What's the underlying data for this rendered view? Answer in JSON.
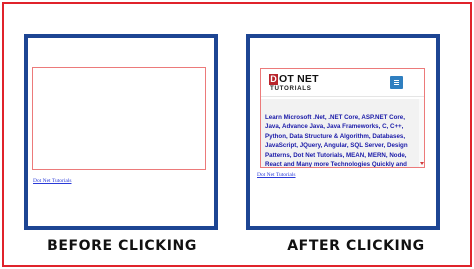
{
  "before": {
    "link_text": "Dot Net Tutorials",
    "caption": "BEFORE CLICKING"
  },
  "after": {
    "logo": {
      "box_letter": "D",
      "top_text": "OT NET",
      "bottom_text": "TUTORIALS"
    },
    "menu_icon": "hamburger-menu-icon",
    "content_text": "Learn Microsoft .Net, .NET Core, ASP.NET Core, Java, Advance Java, Java Frameworks, C, C++, Python, Data Structure & Algorithm, Databases, JavaScript, JQuery, Angular, SQL Server, Design Patterns, Dot Net Tutorials, MEAN, MERN, Node, React and Many more Technologies Quickly and",
    "link_text": "Dot Net Tutorials",
    "caption": "AFTER CLICKING"
  },
  "colors": {
    "outer_border": "#e0232b",
    "panel_border": "#1d4593",
    "iframe_border": "#ec7a7a",
    "link": "#2a3ad8",
    "logo_red": "#b9252c",
    "menu_blue": "#2f7fc0",
    "content_text": "#1a1aa8"
  }
}
